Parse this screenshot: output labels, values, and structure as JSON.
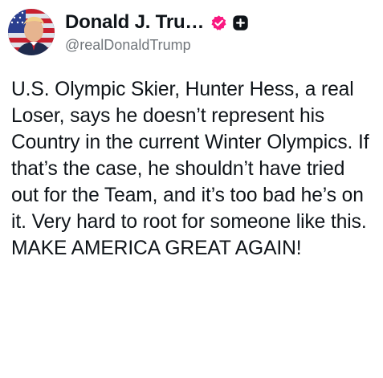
{
  "post": {
    "author": {
      "display_name": "Donald J. Tru…",
      "handle": "@realDonaldTrump",
      "avatar_icon": "profile-avatar-flag-portrait",
      "verified_icon": "verified-badge-icon",
      "verified_color": "#f91880",
      "plus_icon": "square-plus-icon"
    },
    "text": "U.S. Olympic Skier, Hunter Hess, a real Loser, says he doesn’t represent his Country in the current Winter Olympics. If that’s the case, he shouldn’t have tried out for the Team, and it’s too bad he’s on it. Very hard to root for someone like this. MAKE AMERICA GREAT AGAIN!"
  }
}
